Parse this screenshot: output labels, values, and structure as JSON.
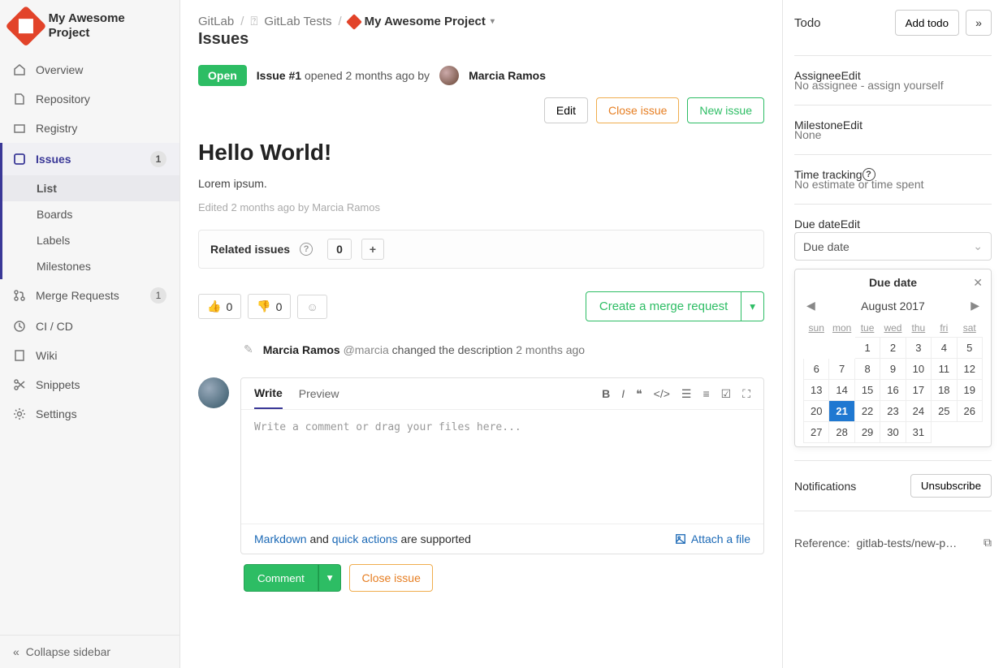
{
  "project_name": "My Awesome Project",
  "sidebar": {
    "items": [
      {
        "label": "Overview"
      },
      {
        "label": "Repository"
      },
      {
        "label": "Registry"
      },
      {
        "label": "Issues",
        "count": "1"
      },
      {
        "label": "Merge Requests",
        "count": "1"
      },
      {
        "label": "CI / CD"
      },
      {
        "label": "Wiki"
      },
      {
        "label": "Snippets"
      },
      {
        "label": "Settings"
      }
    ],
    "issues_sub": [
      "List",
      "Boards",
      "Labels",
      "Milestones"
    ],
    "collapse": "Collapse sidebar"
  },
  "breadcrumb": {
    "root": "GitLab",
    "group": "GitLab Tests",
    "project": "My Awesome Project",
    "page": "Issues"
  },
  "issue": {
    "status": "Open",
    "id_label": "Issue #1",
    "opened": "opened 2 months ago by",
    "author": "Marcia Ramos",
    "title": "Hello World!",
    "body": "Lorem ipsum.",
    "edited_note": "Edited 2 months ago by Marcia Ramos",
    "related_label": "Related issues",
    "related_count": "0",
    "thumbs_up": "0",
    "thumbs_down": "0",
    "merge_btn": "Create a merge request",
    "activity": {
      "author": "Marcia Ramos",
      "mention": "@marcia",
      "action": "changed the description",
      "time": "2 months ago"
    },
    "buttons": {
      "edit": "Edit",
      "close": "Close issue",
      "new": "New issue"
    }
  },
  "editor": {
    "tab_write": "Write",
    "tab_preview": "Preview",
    "placeholder": "Write a comment or drag your files here...",
    "md_link": "Markdown",
    "foot_mid": " and ",
    "qa_link": "quick actions",
    "foot_end": " are supported",
    "attach": "Attach a file",
    "comment": "Comment",
    "close": "Close issue"
  },
  "right": {
    "todo_label": "Todo",
    "add_todo": "Add todo",
    "assignee_label": "Assignee",
    "assignee_value": "No assignee - assign yourself",
    "milestone_label": "Milestone",
    "milestone_value": "None",
    "time_label": "Time tracking",
    "time_value": "No estimate or time spent",
    "due_label": "Due date",
    "due_placeholder": "Due date",
    "edit": "Edit",
    "notifications": "Notifications",
    "unsubscribe": "Unsubscribe",
    "reference_label": "Reference:",
    "reference_value": "gitlab-tests/new-p…"
  },
  "datepicker": {
    "title": "Due date",
    "month": "August",
    "year": "2017",
    "dow": [
      "sun",
      "mon",
      "tue",
      "wed",
      "thu",
      "fri",
      "sat"
    ],
    "weeks": [
      [
        "",
        "",
        "1",
        "2",
        "3",
        "4",
        "5"
      ],
      [
        "6",
        "7",
        "8",
        "9",
        "10",
        "11",
        "12"
      ],
      [
        "13",
        "14",
        "15",
        "16",
        "17",
        "18",
        "19"
      ],
      [
        "20",
        "21",
        "22",
        "23",
        "24",
        "25",
        "26"
      ],
      [
        "27",
        "28",
        "29",
        "30",
        "31",
        "",
        ""
      ]
    ],
    "selected": "21"
  }
}
